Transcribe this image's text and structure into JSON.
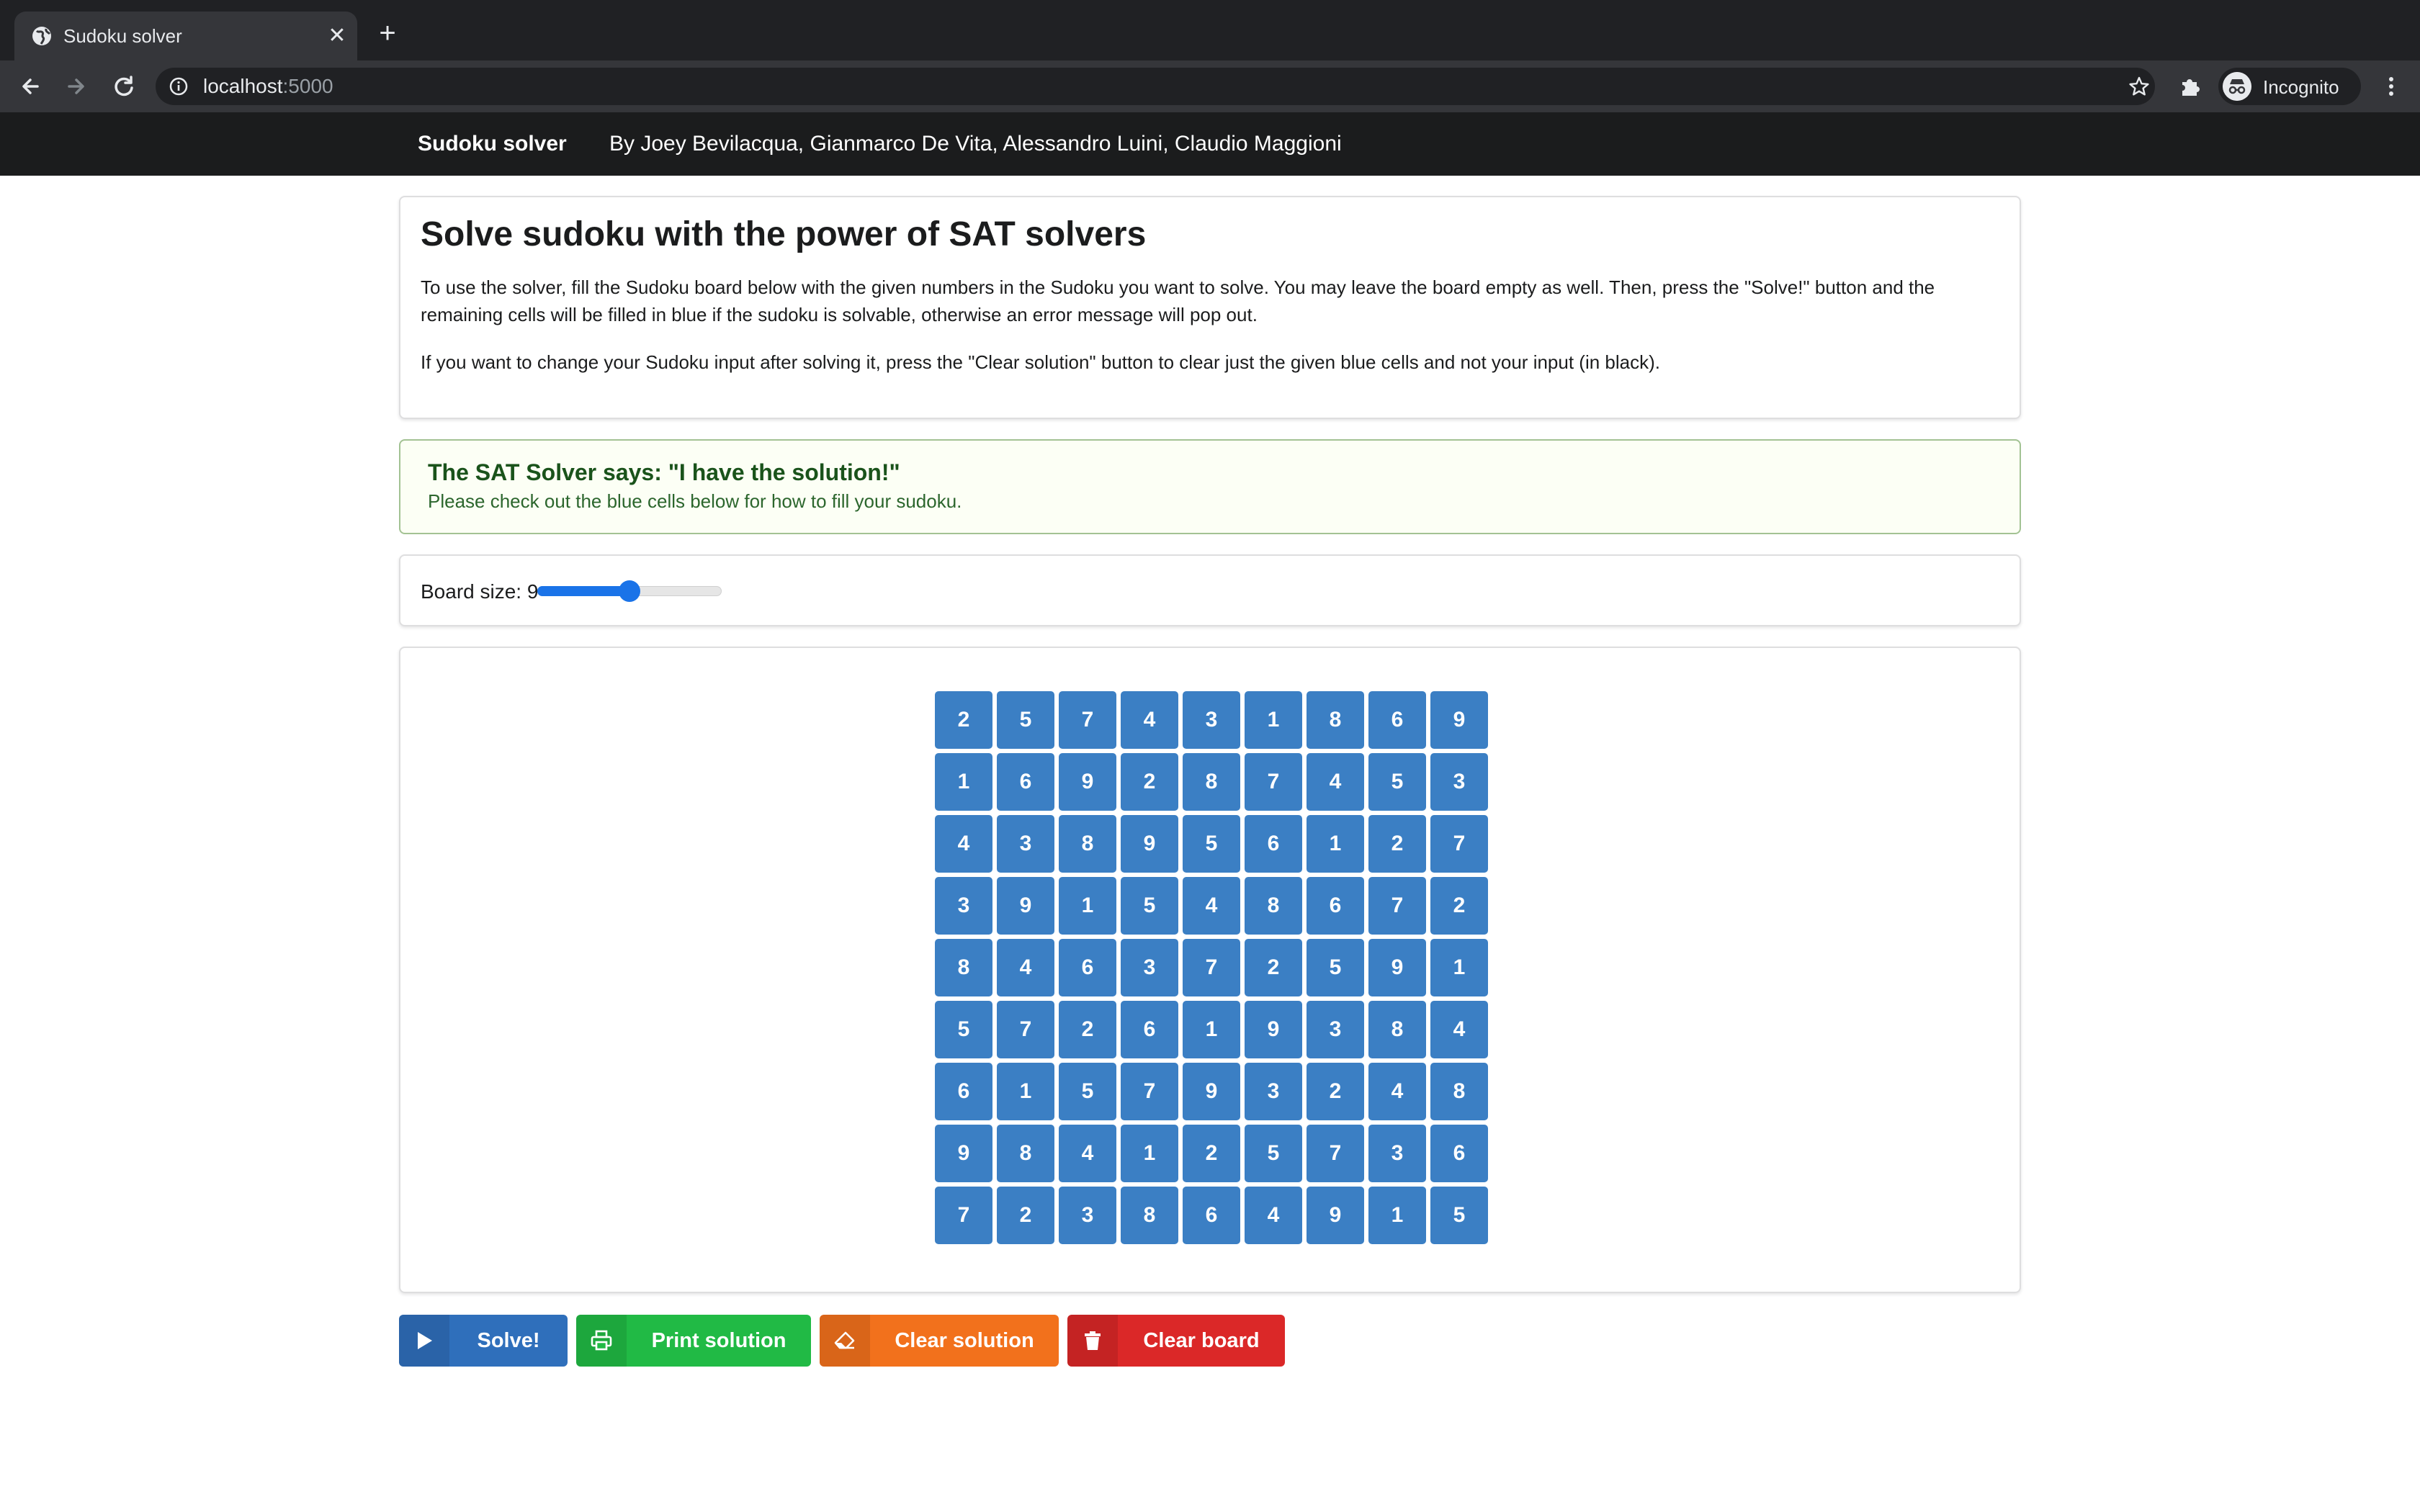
{
  "browser": {
    "tab_title": "Sudoku solver",
    "new_tab_symbol": "+",
    "close_symbol": "✕",
    "url_host": "localhost",
    "url_port": ":5000",
    "profile_label": "Incognito",
    "icons": [
      "globe-icon",
      "close-icon",
      "plus-icon",
      "back-arrow-icon",
      "forward-arrow-icon",
      "reload-icon",
      "info-icon",
      "star-icon",
      "puzzle-icon",
      "incognito-icon",
      "kebab-menu-icon"
    ]
  },
  "nav": {
    "brand": "Sudoku solver",
    "authors": "By Joey Bevilacqua, Gianmarco De Vita, Alessandro Luini, Claudio Maggioni"
  },
  "intro": {
    "title": "Solve sudoku with the power of SAT solvers",
    "p1": "To use the solver, fill the Sudoku board below with the given numbers in the Sudoku you want to solve. You may leave the board empty as well. Then, press the \"Solve!\" button and the remaining cells will be filled in blue if the sudoku is solvable, otherwise an error message will pop out.",
    "p2": "If you want to change your Sudoku input after solving it, press the \"Clear solution\" button to clear just the given blue cells and not your input (in black)."
  },
  "message": {
    "header": "The SAT Solver says: \"I have the solution!\"",
    "body": "Please check out the blue cells below for how to fill your sudoku."
  },
  "board_size": {
    "label": "Board size: 9",
    "value": 9,
    "slider_fraction": 0.5
  },
  "board": {
    "cell_color": "#3b7fc4",
    "rows": [
      [
        "2",
        "5",
        "7",
        "4",
        "3",
        "1",
        "8",
        "6",
        "9"
      ],
      [
        "1",
        "6",
        "9",
        "2",
        "8",
        "7",
        "4",
        "5",
        "3"
      ],
      [
        "4",
        "3",
        "8",
        "9",
        "5",
        "6",
        "1",
        "2",
        "7"
      ],
      [
        "3",
        "9",
        "1",
        "5",
        "4",
        "8",
        "6",
        "7",
        "2"
      ],
      [
        "8",
        "4",
        "6",
        "3",
        "7",
        "2",
        "5",
        "9",
        "1"
      ],
      [
        "5",
        "7",
        "2",
        "6",
        "1",
        "9",
        "3",
        "8",
        "4"
      ],
      [
        "6",
        "1",
        "5",
        "7",
        "9",
        "3",
        "2",
        "4",
        "8"
      ],
      [
        "9",
        "8",
        "4",
        "1",
        "2",
        "5",
        "7",
        "3",
        "6"
      ],
      [
        "7",
        "2",
        "3",
        "8",
        "6",
        "4",
        "9",
        "1",
        "5"
      ]
    ]
  },
  "buttons": {
    "solve": {
      "label": "Solve!",
      "color": "#2f6fbb",
      "icon": "play-icon"
    },
    "print": {
      "label": "Print solution",
      "color": "#21ba45",
      "icon": "print-icon"
    },
    "clear_solution": {
      "label": "Clear solution",
      "color": "#f2711c",
      "icon": "eraser-icon"
    },
    "clear_board": {
      "label": "Clear board",
      "color": "#db2828",
      "icon": "trash-icon"
    }
  }
}
